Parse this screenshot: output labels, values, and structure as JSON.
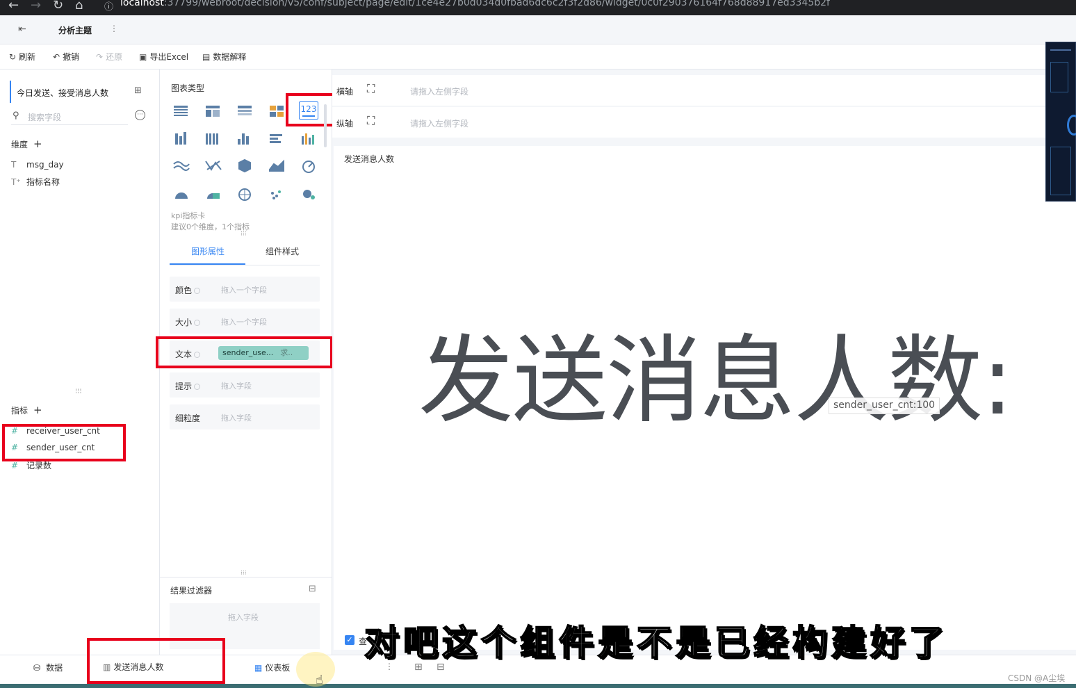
{
  "browser": {
    "url_host": "localhost",
    "url_path": ":37799/webroot/decision/v5/conf/subject/page/edit/1ce4e27b0d034d0fbad6dc6c2f3f2d86/widget/0c0f290376164f768d88917ed3345b2f"
  },
  "header": {
    "title": "分析主题"
  },
  "toolbar": {
    "refresh": "刷新",
    "undo": "撤销",
    "redo": "还原",
    "export_excel": "导出Excel",
    "data_explain": "数据解释"
  },
  "left_panel": {
    "dataset_name": "今日发送、接受消息人数",
    "search_placeholder": "搜索字段",
    "dimensions_label": "维度",
    "dimensions": [
      "msg_day",
      "指标名称"
    ],
    "measures_label": "指标",
    "measures": [
      "receiver_user_cnt",
      "sender_user_cnt",
      "记录数"
    ]
  },
  "mid_panel": {
    "chart_type_label": "图表类型",
    "kpi_icon_text": "123",
    "chart_hint_name": "kpi指标卡",
    "chart_hint_desc": "建议0个维度，1个指标",
    "tabs": [
      "图形属性",
      "组件样式"
    ],
    "props": [
      {
        "label": "颜色",
        "placeholder": "拖入一个字段"
      },
      {
        "label": "大小",
        "placeholder": "拖入一个字段"
      },
      {
        "label": "文本",
        "placeholder": ""
      },
      {
        "label": "提示",
        "placeholder": "拖入字段"
      },
      {
        "label": "细粒度",
        "placeholder": "拖入字段"
      }
    ],
    "text_field_chip": "sender_use...",
    "text_field_agg": "求..",
    "result_filter_label": "结果过滤器",
    "result_filter_placeholder": "拖入字段"
  },
  "main": {
    "x_axis_label": "横轴",
    "y_axis_label": "纵轴",
    "x_axis_placeholder": "请拖入左侧字段",
    "y_axis_placeholder": "请拖入左侧字段",
    "widget_title": "发送消息人数",
    "kpi_text": "发送消息人数:",
    "tooltip": "sender_user_cnt:100",
    "checkbox_label": "查"
  },
  "bottom": {
    "tab_data": "数据",
    "tab_component": "发送消息人数",
    "tab_dashboard": "仪表板",
    "watermark": "CSDN @A尘埃"
  },
  "subtitle": "对吧这个组件是不是已经构建好了",
  "colors": {
    "accent": "#3685f2",
    "highlight": "#e8001c",
    "field_chip": "#8fd0c5",
    "number_icon": "#4fb3a3"
  }
}
